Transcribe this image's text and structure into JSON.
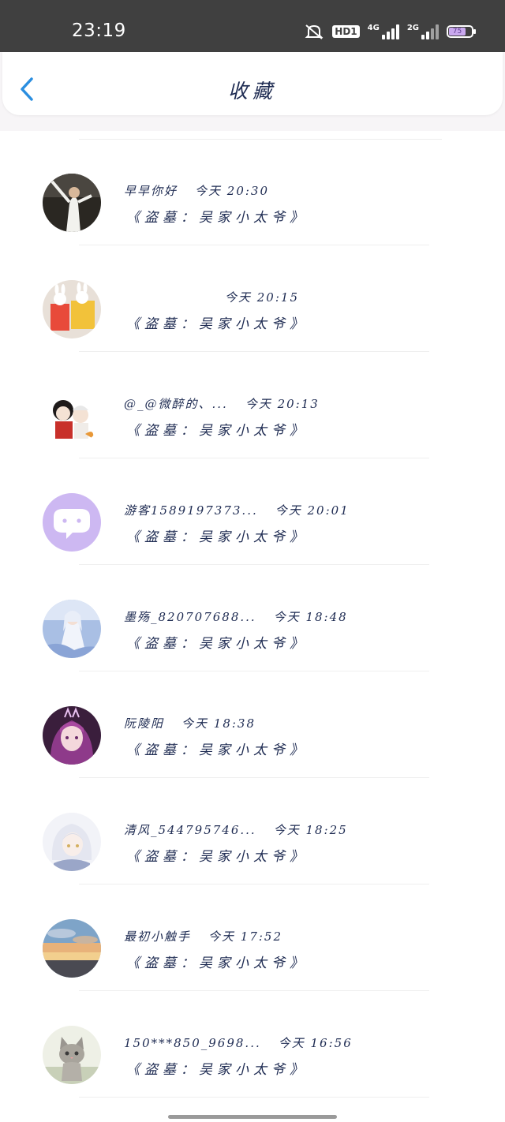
{
  "status_bar": {
    "time": "23:19",
    "hd_label": "HD1",
    "net1_label": "4G",
    "net2_label": "2G",
    "battery_level": "75",
    "icons": [
      "mute-icon",
      "hd-icon",
      "signal-4g-icon",
      "signal-2g-icon",
      "battery-icon"
    ]
  },
  "header": {
    "title": "收藏",
    "back_icon": "chevron-left-icon",
    "accent_color": "#2a8ee0"
  },
  "items": [
    {
      "name": "早早你好",
      "time": "今天 20:30",
      "book": "《盗墓：吴家小太爷》",
      "avatar": "avatar-man-dancing"
    },
    {
      "name": "",
      "time": "今天 20:15",
      "book": "《盗墓：吴家小太爷》",
      "avatar": "avatar-rabbit-figures"
    },
    {
      "name": "@_@微醉的、...",
      "time": "今天 20:13",
      "book": "《盗墓：吴家小太爷》",
      "avatar": "avatar-chibi-couple"
    },
    {
      "name": "游客1589197373...",
      "time": "今天 20:01",
      "book": "《盗墓：吴家小太爷》",
      "avatar": "avatar-default-chat"
    },
    {
      "name": "墨殇_820707688...",
      "time": "今天 18:48",
      "book": "《盗墓：吴家小太爷》",
      "avatar": "avatar-anime-blue"
    },
    {
      "name": "阮陵阳",
      "time": "今天 18:38",
      "book": "《盗墓：吴家小太爷》",
      "avatar": "avatar-purple-hair-girl"
    },
    {
      "name": "清风_544795746...",
      "time": "今天 18:25",
      "book": "《盗墓：吴家小太爷》",
      "avatar": "avatar-white-hair-anime"
    },
    {
      "name": "最初小触手",
      "time": "今天 17:52",
      "book": "《盗墓：吴家小太爷》",
      "avatar": "avatar-sunset-sky"
    },
    {
      "name": "150***850_9698...",
      "time": "今天 16:56",
      "book": "《盗墓：吴家小太爷》",
      "avatar": "avatar-kitten"
    }
  ]
}
